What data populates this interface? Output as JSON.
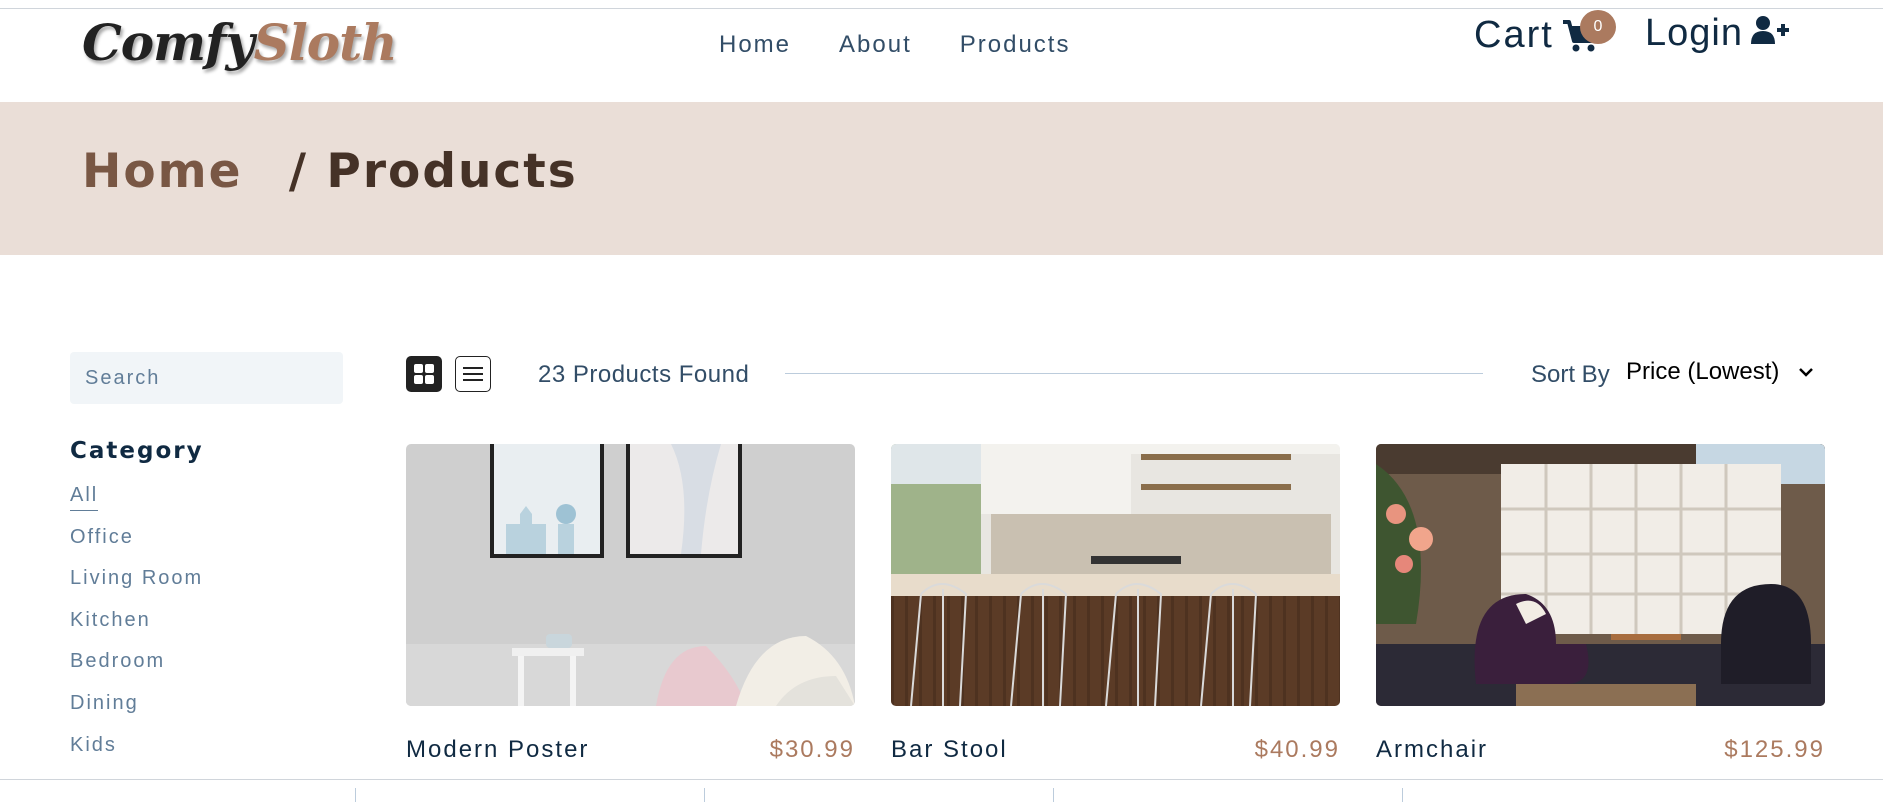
{
  "brand": {
    "part1": "Comfy",
    "part2": "Sloth"
  },
  "nav": {
    "links": [
      "Home",
      "About",
      "Products"
    ]
  },
  "cart": {
    "label": "Cart",
    "count": "0"
  },
  "login": {
    "label": "Login"
  },
  "breadcrumb": {
    "home": "Home",
    "separator": "/",
    "current": "Products"
  },
  "filters": {
    "search_placeholder": "Search",
    "category_title": "Category",
    "categories": [
      "All",
      "Office",
      "Living Room",
      "Kitchen",
      "Bedroom",
      "Dining",
      "Kids"
    ],
    "active_category": "All"
  },
  "toolbar": {
    "products_found": "23 Products Found",
    "sort_label": "Sort By",
    "sort_value": "Price (Lowest)"
  },
  "products": [
    {
      "name": "Modern Poster",
      "price": "$30.99"
    },
    {
      "name": "Bar Stool",
      "price": "$40.99"
    },
    {
      "name": "Armchair",
      "price": "$125.99"
    }
  ],
  "colors": {
    "accent": "#ab7a5f",
    "hero_bg": "#eaded7",
    "text_dark": "#102a42"
  }
}
